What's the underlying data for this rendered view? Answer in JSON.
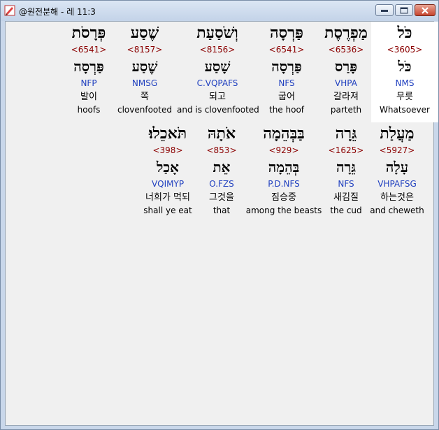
{
  "window": {
    "title": "@원전분해 - 레 11:3"
  },
  "rows": [
    [
      {
        "hebrew": "כֹּל",
        "strong": "<3605>",
        "root": "כֹּל",
        "morph": "NMS",
        "korean": "무릇",
        "english": "Whatsoever",
        "highlight": true
      },
      {
        "hebrew": "מַפְרֶסֶת",
        "strong": "<6536>",
        "root": "פָּרַס",
        "morph": "VHPA",
        "korean": "갈라져",
        "english": "parteth",
        "highlight": false
      },
      {
        "hebrew": "פַּרְסָה",
        "strong": "<6541>",
        "root": "פַּרְסָה",
        "morph": "NFS",
        "korean": "굽어",
        "english": "the hoof",
        "highlight": false
      },
      {
        "hebrew": "וְשֹׁסַעַת",
        "strong": "<8156>",
        "root": "שָׁסַע",
        "morph": "C.VQPAFS",
        "korean": "되고",
        "english": "and is clovenfooted",
        "highlight": false
      },
      {
        "hebrew": "שֶׁסַע",
        "strong": "<8157>",
        "root": "שֶׁסַע",
        "morph": "NMSG",
        "korean": "쪽",
        "english": "clovenfooted",
        "highlight": false
      },
      {
        "hebrew": "פְּרָסֹת",
        "strong": "<6541>",
        "root": "פַּרְסָה",
        "morph": "NFP",
        "korean": "발이",
        "english": "hoofs",
        "highlight": false
      }
    ],
    [
      {
        "hebrew": "מַעֲלַת",
        "strong": "<5927>",
        "root": "עָלָה",
        "morph": "VHPAFSG",
        "korean": "하는것은",
        "english": "and cheweth",
        "highlight": false
      },
      {
        "hebrew": "גֵּרָה",
        "strong": "<1625>",
        "root": "גֵּרָה",
        "morph": "NFS",
        "korean": "새김질",
        "english": "the cud",
        "highlight": false
      },
      {
        "hebrew": "בַּבְּהֵמָה",
        "strong": "<929>",
        "root": "בְּהֵמָה",
        "morph": "P.D.NFS",
        "korean": "짐승중",
        "english": "among the beasts",
        "highlight": false
      },
      {
        "hebrew": "אֹתָהּ",
        "strong": "<853>",
        "root": "אֵת",
        "morph": "O.FZS",
        "korean": "그것을",
        "english": "that",
        "highlight": false
      },
      {
        "hebrew": "תֹּאכֵלוּ׃",
        "strong": "<398>",
        "root": "אָכַל",
        "morph": "VQIMYP",
        "korean": "너희가 먹되",
        "english": "shall ye eat",
        "highlight": false
      }
    ]
  ]
}
